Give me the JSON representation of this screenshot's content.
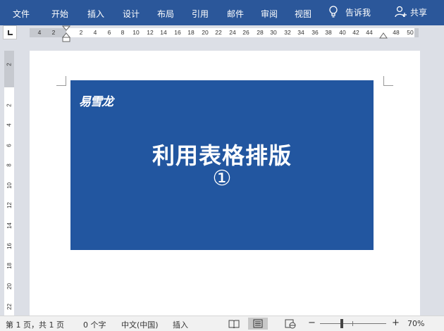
{
  "ribbon": {
    "tabs": [
      "文件",
      "开始",
      "插入",
      "设计",
      "布局",
      "引用",
      "邮件",
      "审阅",
      "视图"
    ],
    "tell_me": "告诉我",
    "share": "共享"
  },
  "ruler": {
    "h_labels": [
      "4",
      "2",
      "2",
      "4",
      "6",
      "8",
      "10",
      "12",
      "14",
      "16",
      "18",
      "20",
      "22",
      "24",
      "26",
      "28",
      "30",
      "32",
      "34",
      "36",
      "38",
      "40",
      "42",
      "44",
      "48",
      "50"
    ],
    "v_labels": [
      "2",
      "2",
      "4",
      "6",
      "8",
      "10",
      "12",
      "14",
      "16",
      "18",
      "20",
      "22"
    ]
  },
  "document": {
    "logo": "易雪龙",
    "headline": "利用表格排版",
    "numeral": "①"
  },
  "statusbar": {
    "page": "第 1 页，共 1 页",
    "words": "0 个字",
    "language": "中文(中国)",
    "mode": "插入",
    "zoom_minus": "−",
    "zoom_plus": "+",
    "zoom": "70%",
    "zoom_level_percent": 70
  },
  "colors": {
    "ribbon": "#2b579a",
    "banner": "#2256a0"
  }
}
